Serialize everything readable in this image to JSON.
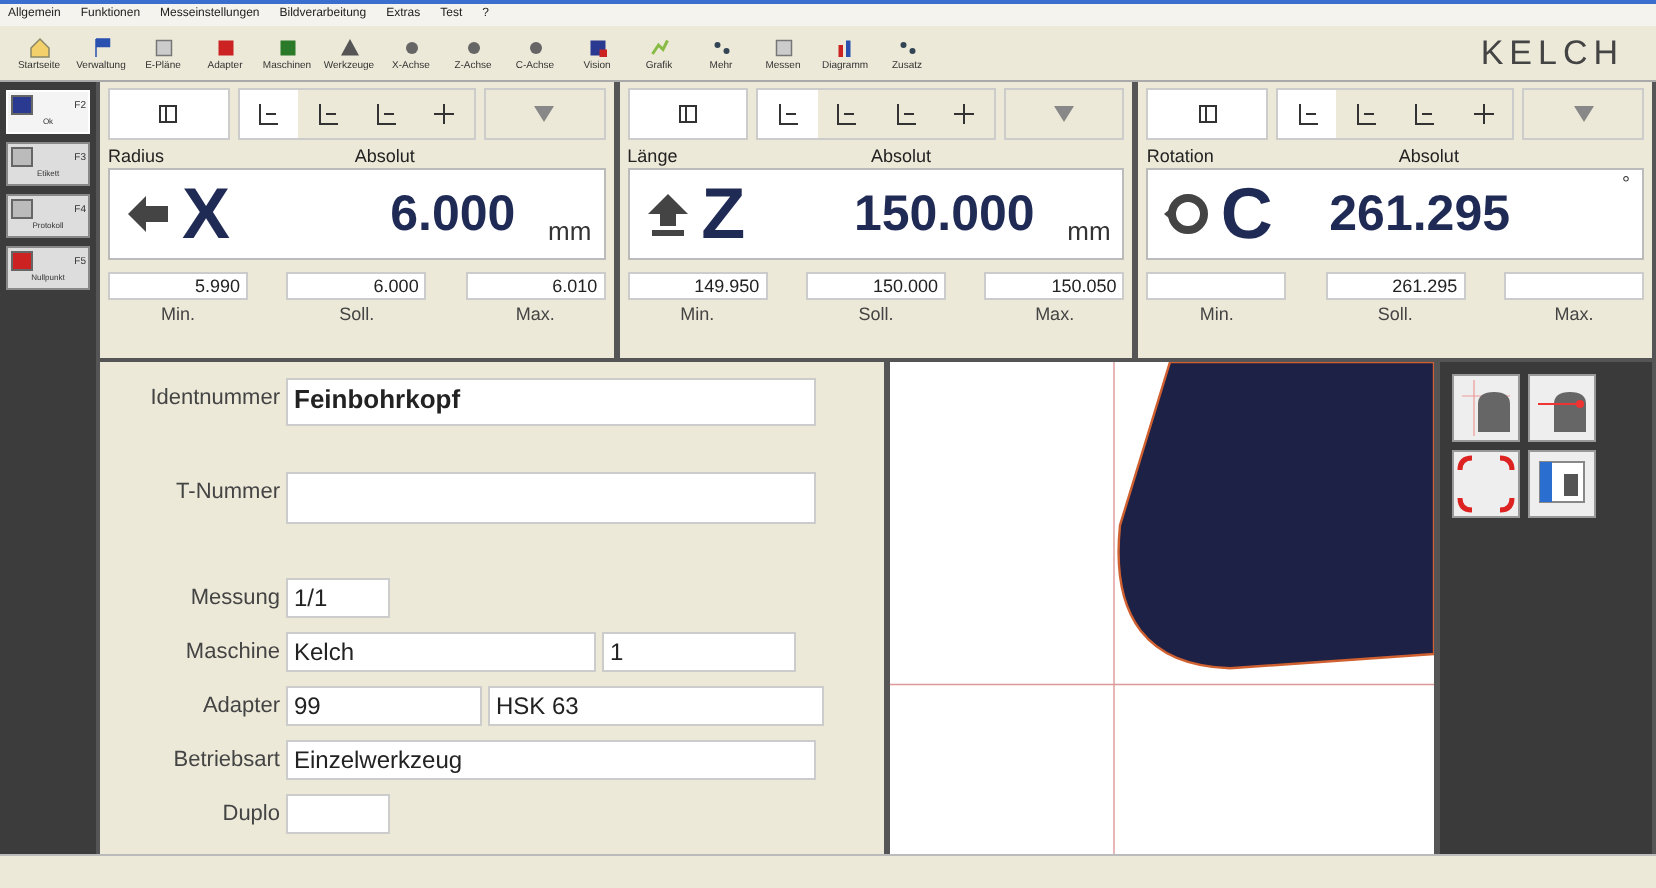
{
  "menu": [
    "Allgemein",
    "Funktionen",
    "Messeinstellungen",
    "Bildverarbeitung",
    "Extras",
    "Test",
    "?"
  ],
  "toolbar": [
    {
      "label": "Startseite",
      "kind": "home"
    },
    {
      "label": "Verwaltung",
      "kind": "flag"
    },
    {
      "label": "E-Pläne",
      "kind": "doc"
    },
    {
      "label": "Adapter",
      "kind": "adapter"
    },
    {
      "label": "Maschinen",
      "kind": "machine"
    },
    {
      "label": "Werkzeuge",
      "kind": "tool"
    },
    {
      "label": "X-Achse",
      "kind": "axis"
    },
    {
      "label": "Z-Achse",
      "kind": "axis"
    },
    {
      "label": "C-Achse",
      "kind": "axis"
    },
    {
      "label": "Vision",
      "kind": "vision"
    },
    {
      "label": "Grafik",
      "kind": "graph"
    },
    {
      "label": "Mehr",
      "kind": "more"
    },
    {
      "label": "Messen",
      "kind": "doc"
    },
    {
      "label": "Diagramm",
      "kind": "chart"
    },
    {
      "label": "Zusatz",
      "kind": "more"
    }
  ],
  "brand": "KELCH",
  "sidebar": [
    {
      "key": "F2",
      "label": "Ok",
      "selected": true
    },
    {
      "key": "F3",
      "label": "Etikett",
      "selected": false
    },
    {
      "key": "F4",
      "label": "Protokoll",
      "selected": false
    },
    {
      "key": "F5",
      "label": "Nullpunkt",
      "selected": false
    }
  ],
  "axes": [
    {
      "name": "Radius",
      "mode": "Absolut",
      "axis": "X",
      "value": "6.000",
      "unit": "mm",
      "mode_buttons": [
        {
          "selected": true
        },
        {
          "selected": false
        },
        {
          "selected": false
        },
        {
          "selected": false
        }
      ],
      "fields": [
        {
          "value": "5.990",
          "label": "Min."
        },
        {
          "value": "6.000",
          "label": "Soll."
        },
        {
          "value": "6.010",
          "label": "Max."
        }
      ]
    },
    {
      "name": "Länge",
      "mode": "Absolut",
      "axis": "Z",
      "value": "150.000",
      "unit": "mm",
      "mode_buttons": [
        {
          "selected": true
        },
        {
          "selected": false
        },
        {
          "selected": false
        },
        {
          "selected": false
        }
      ],
      "fields": [
        {
          "value": "149.950",
          "label": "Min."
        },
        {
          "value": "150.000",
          "label": "Soll."
        },
        {
          "value": "150.050",
          "label": "Max."
        }
      ]
    },
    {
      "name": "Rotation",
      "mode": "Absolut",
      "axis": "C",
      "value": "261.295",
      "unit": "°",
      "mode_buttons": [
        {
          "selected": true
        },
        {
          "selected": false
        },
        {
          "selected": false
        },
        {
          "selected": false
        }
      ],
      "fields": [
        {
          "label": "Min."
        },
        {
          "value": "261.295",
          "label": "Soll."
        },
        {
          "label": "Max."
        }
      ]
    }
  ],
  "form": [
    {
      "label": "Identnummer",
      "kind": "big",
      "values": [
        "Feinbohrkopf"
      ]
    },
    {
      "label": "T-Nummer",
      "kind": "tall"
    },
    {
      "label": "Messung",
      "kind": "short",
      "values": [
        "1/1"
      ]
    },
    {
      "label": "Maschine",
      "kind": "pair",
      "values": [
        "Kelch",
        "1"
      ]
    },
    {
      "label": "Adapter",
      "kind": "pair",
      "values": [
        "99",
        "HSK 63"
      ]
    },
    {
      "label": "Betriebsart",
      "kind": "wide",
      "values": [
        "Einzelwerkzeug"
      ]
    },
    {
      "label": "Duplo",
      "kind": "short"
    }
  ]
}
